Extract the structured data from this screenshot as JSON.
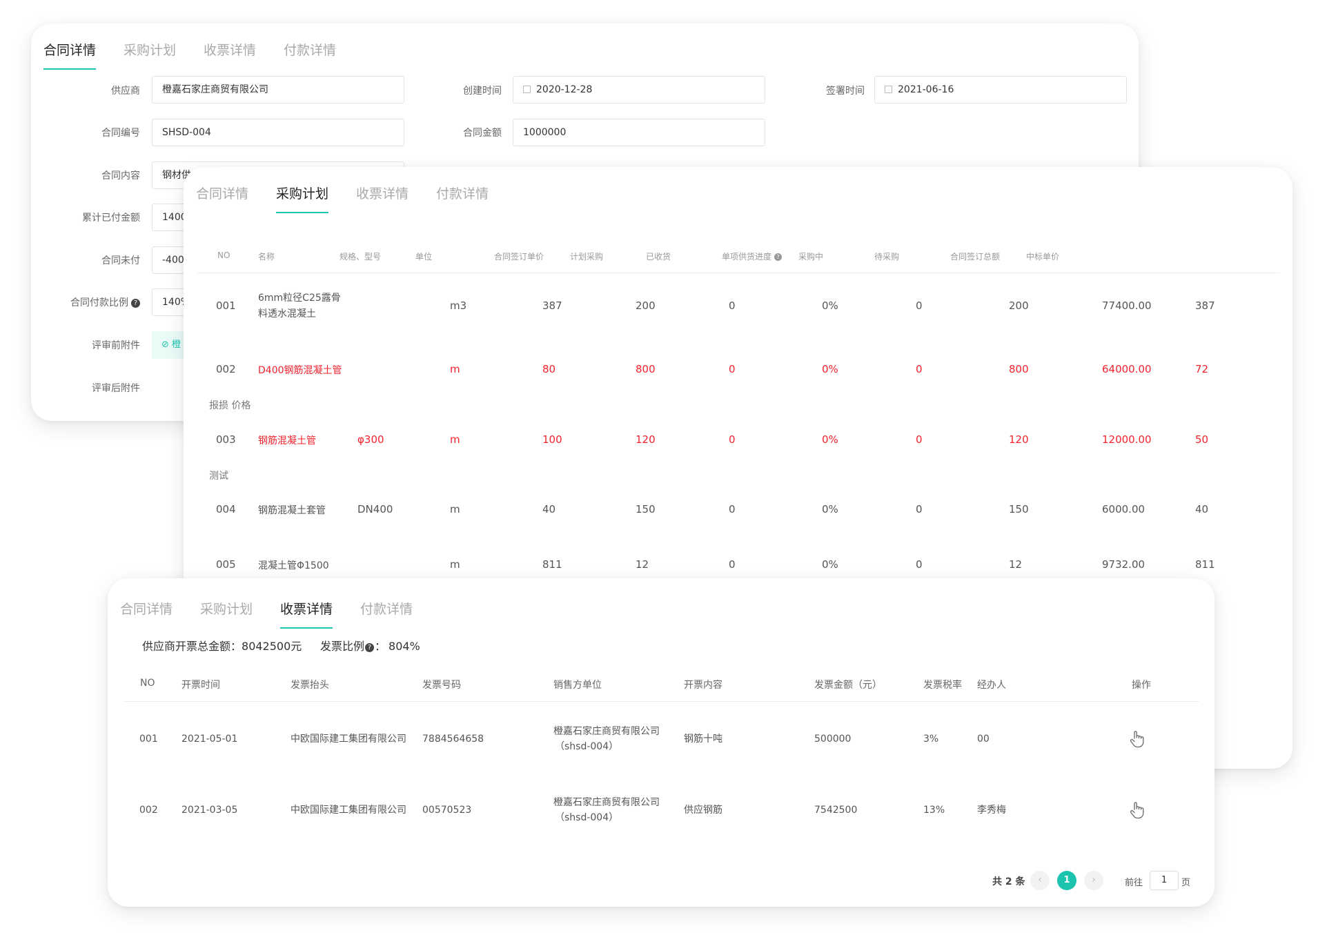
{
  "tabs": [
    "合同详情",
    "采购计划",
    "收票详情",
    "付款详情"
  ],
  "contract": {
    "supplier_label": "供应商",
    "supplier": "橙嘉石家庄商贸有限公司",
    "created_label": "创建时间",
    "created": "2020-12-28",
    "signed_label": "签署时间",
    "signed": "2021-06-16",
    "code_label": "合同编号",
    "code": "SHSD-004",
    "amount_label": "合同金额",
    "amount": "1000000",
    "content_label": "合同内容",
    "content": "钢材供",
    "paid_label": "累计已付金额",
    "paid": "1400",
    "unpaid_label": "合同未付",
    "unpaid": "-400",
    "ratio_label": "合同付款比例",
    "ratio": "140%",
    "pre_attach_label": "评审前附件",
    "pre_attach": "橙",
    "post_attach_label": "评审后附件"
  },
  "plan": {
    "columns": [
      "NO",
      "名称",
      "规格、型号",
      "单位",
      "合同签订单价",
      "计划采购",
      "已收货",
      "单项供货进度",
      "采购中",
      "待采购",
      "合同签订总额",
      "中标单价"
    ],
    "groups": [
      "报损 价格",
      "测试"
    ],
    "rows": [
      {
        "no": "001",
        "name": "6mm粒径C25露骨",
        "name2": "料透水混凝土",
        "spec": "",
        "unit": "m3",
        "price": "387",
        "plan": "200",
        "received": "0",
        "progress": "0%",
        "buying": "0",
        "pending": "200",
        "total": "77400.00",
        "bid": "387",
        "red": false
      },
      {
        "no": "002",
        "name": "D400钢筋混凝土管",
        "name2": "",
        "spec": "",
        "unit": "m",
        "price": "80",
        "plan": "800",
        "received": "0",
        "progress": "0%",
        "buying": "0",
        "pending": "800",
        "total": "64000.00",
        "bid": "72",
        "red": true
      },
      {
        "no": "003",
        "name": "钢筋混凝土管",
        "name2": "",
        "spec": "φ300",
        "unit": "m",
        "price": "100",
        "plan": "120",
        "received": "0",
        "progress": "0%",
        "buying": "0",
        "pending": "120",
        "total": "12000.00",
        "bid": "50",
        "red": true
      },
      {
        "no": "004",
        "name": "钢筋混凝土套管",
        "name2": "",
        "spec": "DN400",
        "unit": "m",
        "price": "40",
        "plan": "150",
        "received": "0",
        "progress": "0%",
        "buying": "0",
        "pending": "150",
        "total": "6000.00",
        "bid": "40",
        "red": false
      },
      {
        "no": "005",
        "name": "混凝土管Φ1500",
        "name2": "",
        "spec": "",
        "unit": "m",
        "price": "811",
        "plan": "12",
        "received": "0",
        "progress": "0%",
        "buying": "0",
        "pending": "12",
        "total": "9732.00",
        "bid": "811",
        "red": false
      }
    ]
  },
  "invoice": {
    "total_label": "供应商开票总金额：",
    "total": "8042500元",
    "ratio_label": "发票比例",
    "ratio_sep": "：",
    "ratio": "804%",
    "columns": [
      "NO",
      "开票时间",
      "发票抬头",
      "发票号码",
      "销售方单位",
      "开票内容",
      "发票金额（元）",
      "发票税率",
      "经办人",
      "操作"
    ],
    "rows": [
      {
        "no": "001",
        "date": "2021-05-01",
        "title": "中欧国际建工集团有限公司",
        "number": "7884564658",
        "seller": "橙嘉石家庄商贸有限公司",
        "seller_code": "（shsd-004）",
        "content": "钢筋十吨",
        "amount": "500000",
        "tax": "3%",
        "handler": "00"
      },
      {
        "no": "002",
        "date": "2021-03-05",
        "title": "中欧国际建工集团有限公司",
        "number": "00570523",
        "seller": "橙嘉石家庄商贸有限公司",
        "seller_code": "（shsd-004）",
        "content": "供应钢筋",
        "amount": "7542500",
        "tax": "13%",
        "handler": "李秀梅"
      }
    ],
    "pager": {
      "total_text": "共 2 条",
      "prev": "‹",
      "current": "1",
      "next": "›",
      "goto_label": "前往",
      "page_value": "1",
      "page_suffix": "页"
    }
  }
}
